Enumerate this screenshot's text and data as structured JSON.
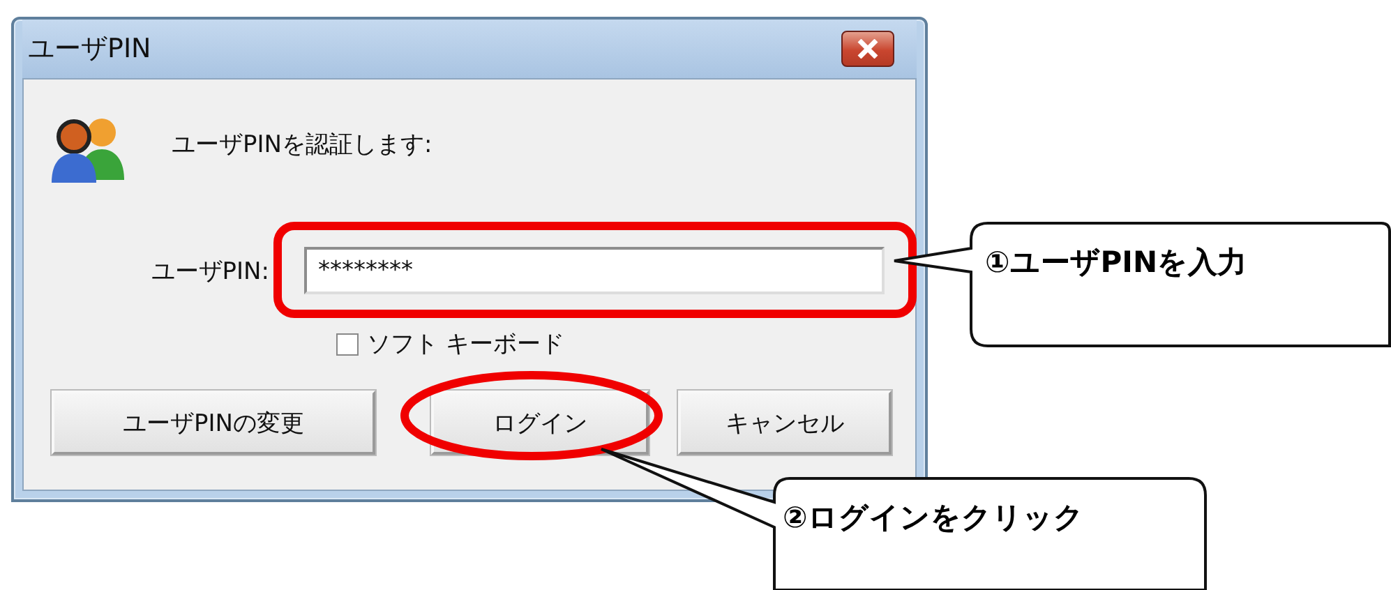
{
  "window": {
    "title": "ユーザPIN"
  },
  "message": "ユーザPINを認証します:",
  "pin_field": {
    "label": "ユーザPIN:",
    "value": "********"
  },
  "soft_keyboard": {
    "label": "ソフト キーボード",
    "checked": false
  },
  "buttons": [
    {
      "label": "ユーザPINの変更"
    },
    {
      "label": "ログイン"
    },
    {
      "label": "キャンセル"
    }
  ],
  "annotations": [
    {
      "text": "①ユーザPINを入力"
    },
    {
      "text": "②ログインをクリック"
    }
  ]
}
